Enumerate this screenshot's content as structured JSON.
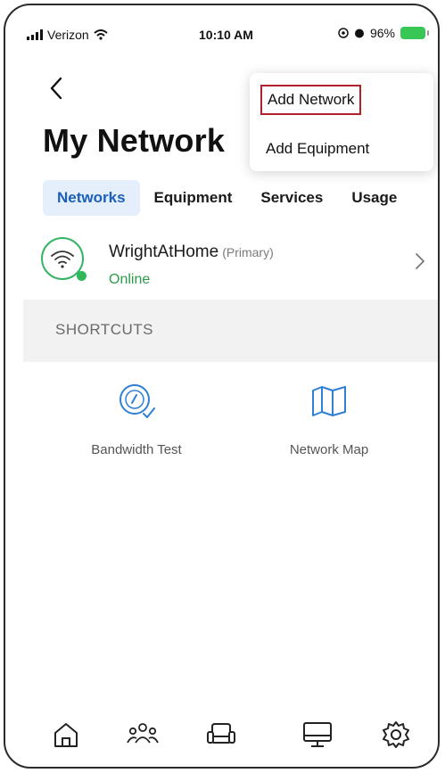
{
  "status_bar": {
    "carrier": "Verizon",
    "time": "10:10 AM",
    "battery": "96%"
  },
  "header": {
    "title": "My Network"
  },
  "dropdown": {
    "items": [
      "Add Network",
      "Add Equipment"
    ]
  },
  "tabs": [
    "Networks",
    "Equipment",
    "Services",
    "Usage"
  ],
  "network": {
    "name": "WrightAtHome",
    "tag": "(Primary)",
    "status": "Online"
  },
  "shortcuts": {
    "title": "SHORTCUTS",
    "items": [
      {
        "label": "Bandwidth Test",
        "icon": "speedometer-icon"
      },
      {
        "label": "Network Map",
        "icon": "map-icon"
      }
    ]
  },
  "bottom_nav": {
    "icons": [
      "home-icon",
      "people-icon",
      "sofa-icon",
      "monitor-icon",
      "gear-icon"
    ]
  },
  "colors": {
    "accent": "#1b5fb8",
    "active_tab_bg": "#e4effb",
    "online": "#2a9d4a",
    "highlight_border": "#b31f2a",
    "icon_blue": "#2f7fd6"
  }
}
